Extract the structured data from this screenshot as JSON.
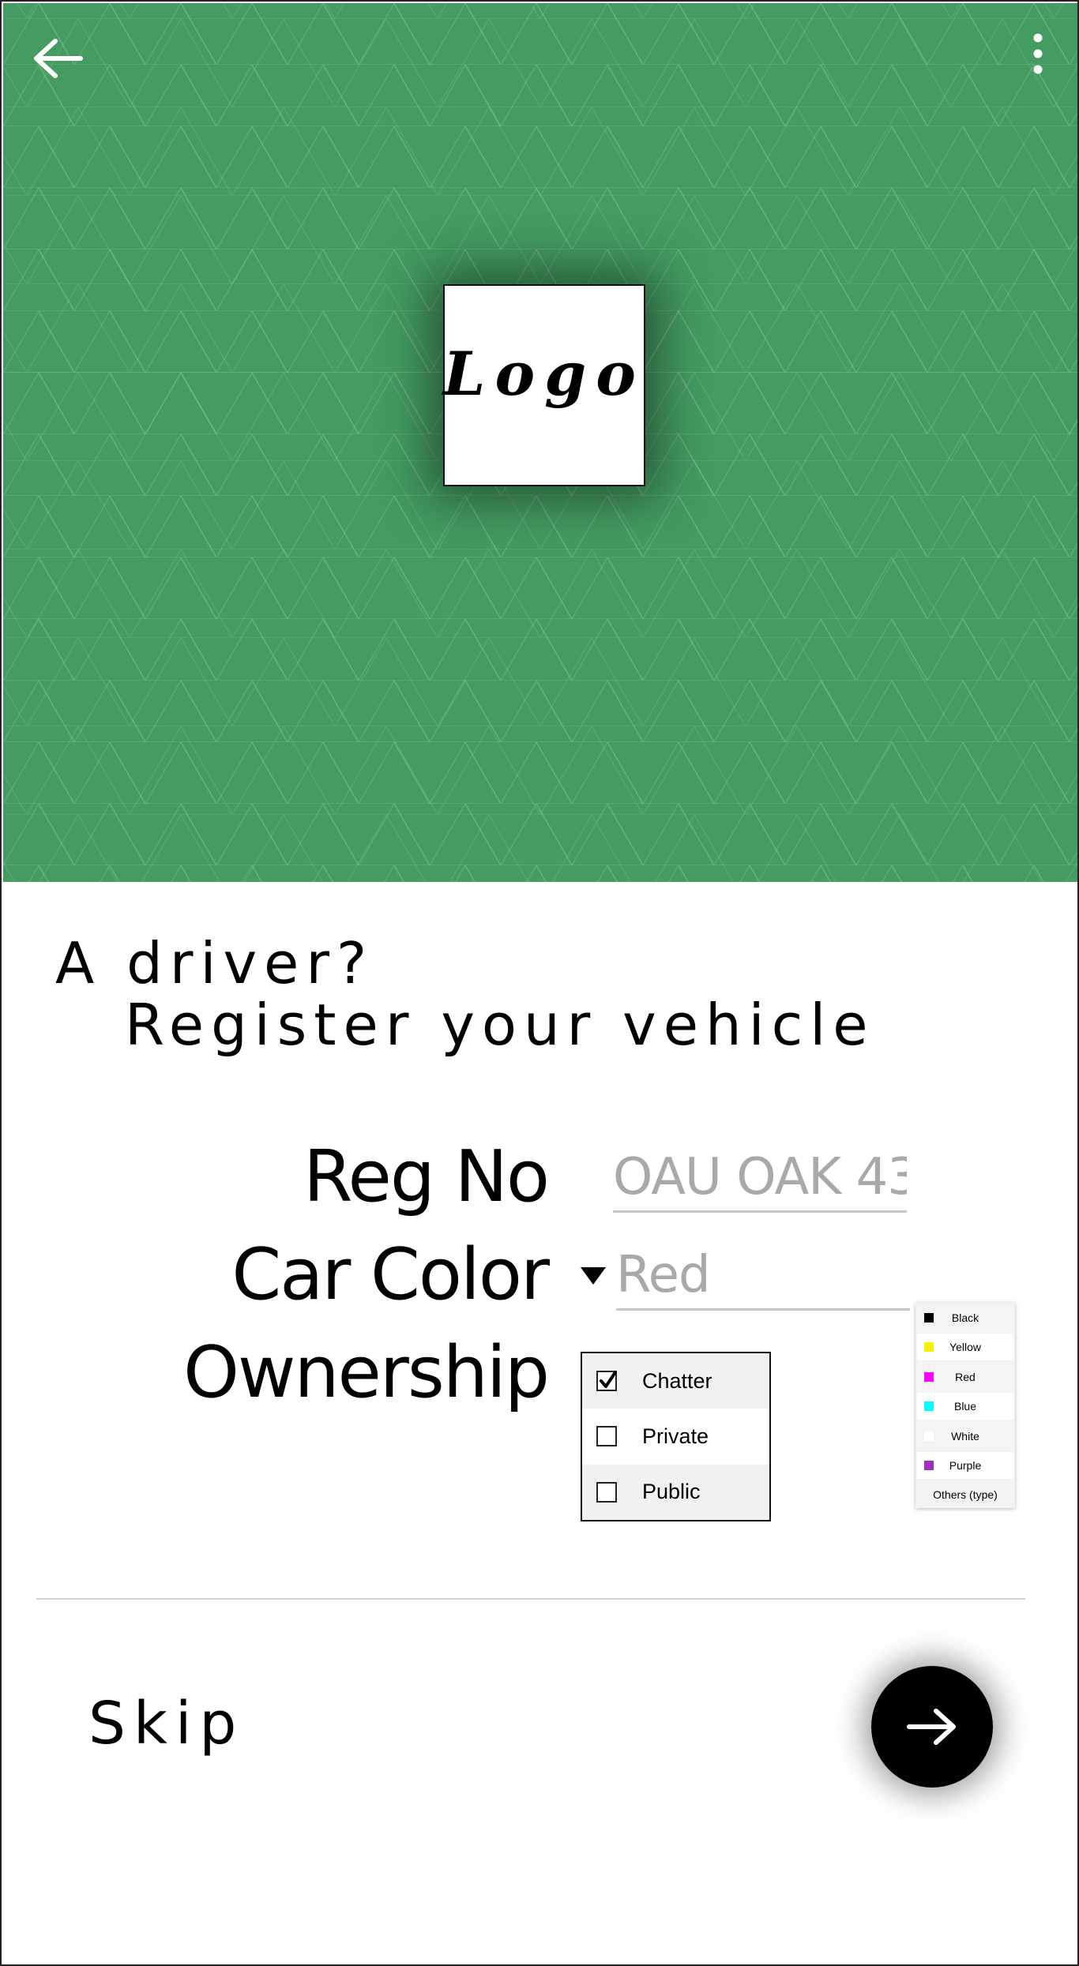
{
  "header": {
    "background_color": "#449c62",
    "back_icon": "arrow-left-icon",
    "menu_icon": "more-vertical-icon",
    "logo_text": "Logo"
  },
  "title": {
    "line1": "A driver?",
    "line2": "Register your vehicle"
  },
  "form": {
    "reg_no": {
      "label": "Reg No",
      "placeholder": "OAU OAK 43"
    },
    "car_color": {
      "label": "Car Color",
      "placeholder": "Red",
      "dropdown_icon": "caret-down-icon",
      "options": [
        {
          "label": "Black",
          "color": "#000000"
        },
        {
          "label": "Yellow",
          "color": "#f5f000"
        },
        {
          "label": "Red",
          "color": "#ff00ff"
        },
        {
          "label": "Blue",
          "color": "#00ffff"
        },
        {
          "label": "White",
          "color": "#ffffff"
        },
        {
          "label": "Purple",
          "color": "#9b30c0"
        },
        {
          "label": "Others (type)",
          "color": ""
        }
      ]
    },
    "ownership": {
      "label": "Ownership",
      "options": [
        {
          "label": "Chatter",
          "checked": true
        },
        {
          "label": "Private",
          "checked": false
        },
        {
          "label": "Public",
          "checked": false
        }
      ]
    }
  },
  "footer": {
    "skip_label": "Skip",
    "next_icon": "arrow-right-icon"
  }
}
